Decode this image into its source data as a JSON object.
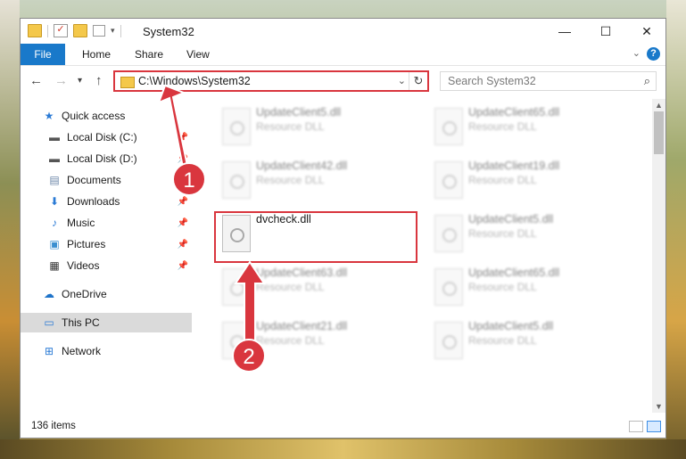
{
  "window": {
    "title": "System32"
  },
  "ribbon": {
    "file": "File",
    "home": "Home",
    "share": "Share",
    "view": "View"
  },
  "address": {
    "path": "C:\\Windows\\System32"
  },
  "search": {
    "placeholder": "Search System32"
  },
  "sidebar": {
    "items": [
      {
        "label": "Quick access",
        "icon": "star-icon"
      },
      {
        "label": "Local Disk (C:)",
        "icon": "drive-icon"
      },
      {
        "label": "Local Disk (D:)",
        "icon": "drive-icon"
      },
      {
        "label": "Documents",
        "icon": "document-icon"
      },
      {
        "label": "Downloads",
        "icon": "download-icon"
      },
      {
        "label": "Music",
        "icon": "music-icon"
      },
      {
        "label": "Pictures",
        "icon": "pictures-icon"
      },
      {
        "label": "Videos",
        "icon": "video-icon"
      },
      {
        "label": "OneDrive",
        "icon": "cloud-icon"
      },
      {
        "label": "This PC",
        "icon": "pc-icon"
      },
      {
        "label": "Network",
        "icon": "network-icon"
      }
    ]
  },
  "files": [
    {
      "name": "UpdateClient5.dll",
      "type": "Resource DLL"
    },
    {
      "name": "UpdateClient65.dll",
      "type": "Resource DLL"
    },
    {
      "name": "UpdateClient42.dll",
      "type": "Resource DLL"
    },
    {
      "name": "UpdateClient19.dll",
      "type": "Resource DLL"
    },
    {
      "name": "dvcheck.dll",
      "type": ""
    },
    {
      "name": "UpdateClient5.dll",
      "type": "Resource DLL"
    },
    {
      "name": "UpdateClient63.dll",
      "type": "Resource DLL"
    },
    {
      "name": "UpdateClient65.dll",
      "type": "Resource DLL"
    },
    {
      "name": "UpdateClient21.dll",
      "type": "Resource DLL"
    },
    {
      "name": "UpdateClient5.dll",
      "type": "Resource DLL"
    }
  ],
  "status": {
    "count": "136 items"
  },
  "callouts": {
    "one": "1",
    "two": "2"
  },
  "colors": {
    "accent": "#1979ca",
    "annotation": "#d9363e"
  }
}
